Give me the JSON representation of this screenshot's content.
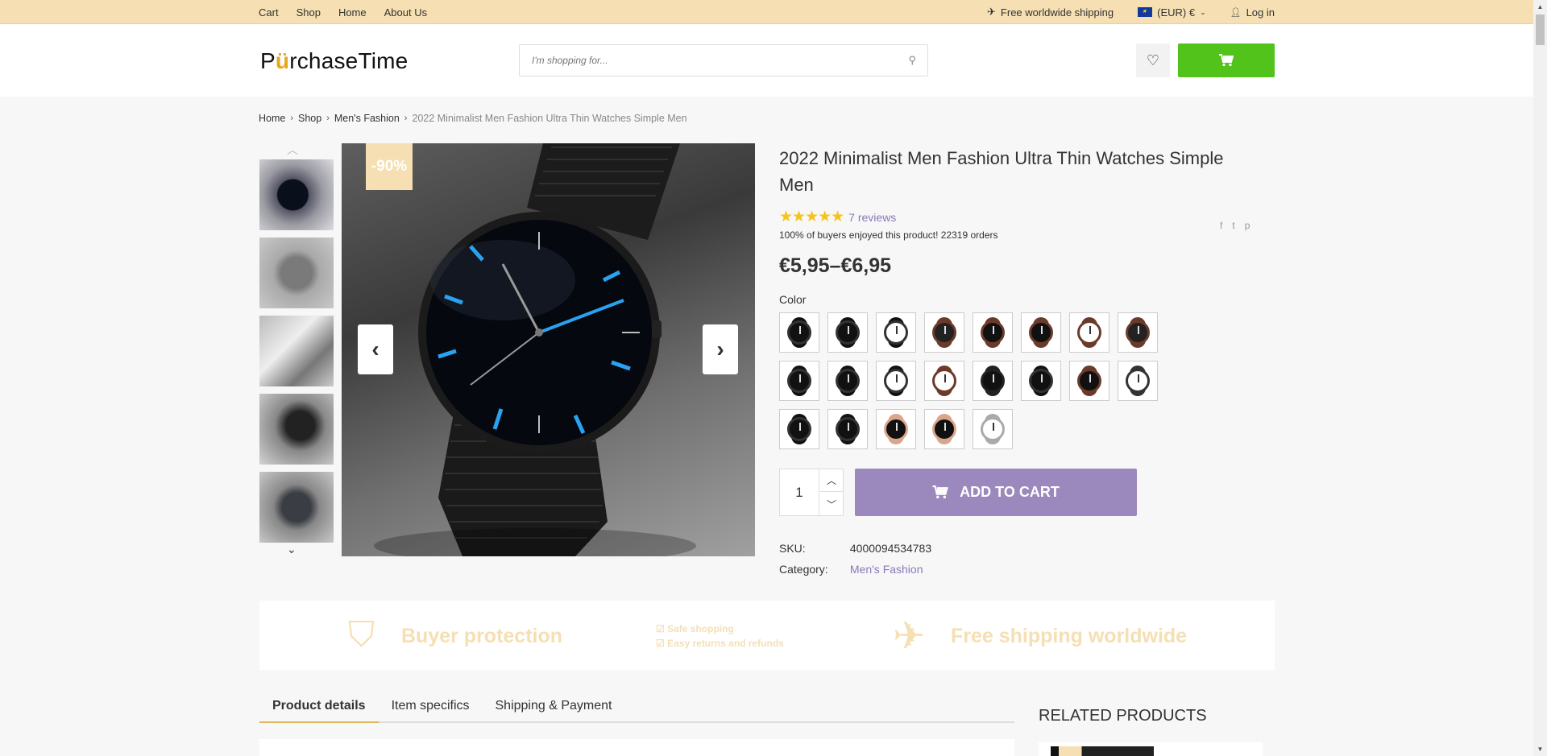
{
  "topbar": {
    "links": [
      "Cart",
      "Shop",
      "Home",
      "About Us"
    ],
    "shipping": "Free worldwide shipping",
    "currency": "(EUR) €",
    "login": "Log in"
  },
  "header": {
    "logo": "PurchaseTime",
    "logo_prefix": "P",
    "logo_suffix": "rchaseTime",
    "search_placeholder": "I'm shopping for..."
  },
  "breadcrumb": [
    "Home",
    "Shop",
    "Men's Fashion",
    "2022 Minimalist Men Fashion Ultra Thin Watches Simple Men"
  ],
  "gallery": {
    "badge": "-90%",
    "thumbnail_count": 5
  },
  "product": {
    "title": "2022 Minimalist Men Fashion Ultra Thin Watches Simple Men",
    "rating_stars": 5,
    "reviews": "7 reviews",
    "buyers_text": "100% of buyers enjoyed this product! 22319 orders",
    "price": "€5,95–€6,95",
    "color_label": "Color",
    "quantity": "1",
    "add_to_cart": "ADD TO CART",
    "sku_label": "SKU:",
    "sku": "4000094534783",
    "category_label": "Category:",
    "category": "Men's Fashion"
  },
  "swatches": [
    {
      "face": "#111",
      "band": "#111"
    },
    {
      "face": "#111",
      "band": "#111"
    },
    {
      "face": "#fff",
      "band": "#111"
    },
    {
      "face": "#222",
      "band": "#6b3a2a"
    },
    {
      "face": "#111",
      "band": "#6b3a2a"
    },
    {
      "face": "#111",
      "band": "#6b3a2a"
    },
    {
      "face": "#fff",
      "band": "#6b3a2a"
    },
    {
      "face": "#222",
      "band": "#6b3a2a"
    },
    {
      "face": "#111",
      "band": "#111"
    },
    {
      "face": "#111",
      "band": "#111"
    },
    {
      "face": "#fff",
      "band": "#111"
    },
    {
      "face": "#fff",
      "band": "#6b3a2a"
    },
    {
      "face": "#111",
      "band": "#222"
    },
    {
      "face": "#111",
      "band": "#111"
    },
    {
      "face": "#111",
      "band": "#6b3a2a"
    },
    {
      "face": "#fff",
      "band": "#333"
    },
    {
      "face": "#111",
      "band": "#111"
    },
    {
      "face": "#111",
      "band": "#111"
    },
    {
      "face": "#111",
      "band": "#d9a68c"
    },
    {
      "face": "#111",
      "band": "#d9a68c"
    },
    {
      "face": "#fff",
      "band": "#aaa"
    }
  ],
  "trust": {
    "buyer_protection": "Buyer protection",
    "safe_shopping": "Safe shopping",
    "easy_returns": "Easy returns and refunds",
    "free_shipping": "Free shipping worldwide"
  },
  "tabs": [
    "Product details",
    "Item specifics",
    "Shipping & Payment"
  ],
  "related_title": "RELATED PRODUCTS",
  "colors": {
    "topbar": "#f5dfb3",
    "cart_button": "#51c31a",
    "add_to_cart": "#9b88bc",
    "link": "#8a78b8",
    "stars": "#f4c31c"
  }
}
